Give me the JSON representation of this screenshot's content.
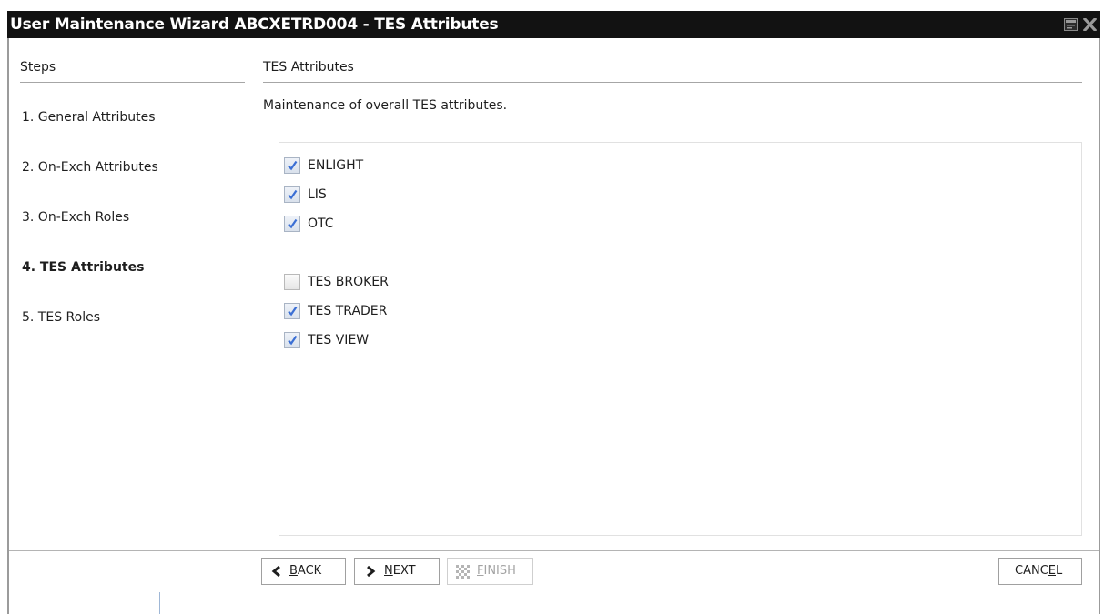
{
  "window": {
    "title": "User Maintenance Wizard ABCXETRD004 - TES Attributes",
    "title_icons": [
      "restore-icon",
      "close-icon"
    ]
  },
  "steps": {
    "header": "Steps",
    "items": [
      {
        "label": "1. General Attributes",
        "active": false
      },
      {
        "label": "2. On-Exch Attributes",
        "active": false
      },
      {
        "label": "3. On-Exch Roles",
        "active": false
      },
      {
        "label": "4. TES Attributes",
        "active": true
      },
      {
        "label": "5. TES Roles",
        "active": false
      }
    ]
  },
  "section": {
    "title": "TES Attributes",
    "description": "Maintenance of overall TES attributes."
  },
  "attributes": {
    "group1": [
      {
        "label": "ENLIGHT",
        "checked": true
      },
      {
        "label": "LIS",
        "checked": true
      },
      {
        "label": "OTC",
        "checked": true
      }
    ],
    "group2": [
      {
        "label": "TES BROKER",
        "checked": false
      },
      {
        "label": "TES TRADER",
        "checked": true
      },
      {
        "label": "TES VIEW",
        "checked": true
      }
    ]
  },
  "buttons": {
    "back": {
      "label_pre": "",
      "mnemonic": "B",
      "label_post": "ACK",
      "icon": "chevron-left-icon"
    },
    "next": {
      "label_pre": "",
      "mnemonic": "N",
      "label_post": "EXT",
      "icon": "chevron-right-icon"
    },
    "finish": {
      "label_pre": "",
      "mnemonic": "F",
      "label_post": "INISH",
      "icon": "checkered-flag-icon",
      "disabled": true
    },
    "cancel": {
      "label_pre": "CANC",
      "mnemonic": "E",
      "label_post": "L"
    }
  },
  "colors": {
    "titlebar_bg": "#121212",
    "titlebar_text": "#ffffff",
    "check_color": "#3b6fd4"
  }
}
